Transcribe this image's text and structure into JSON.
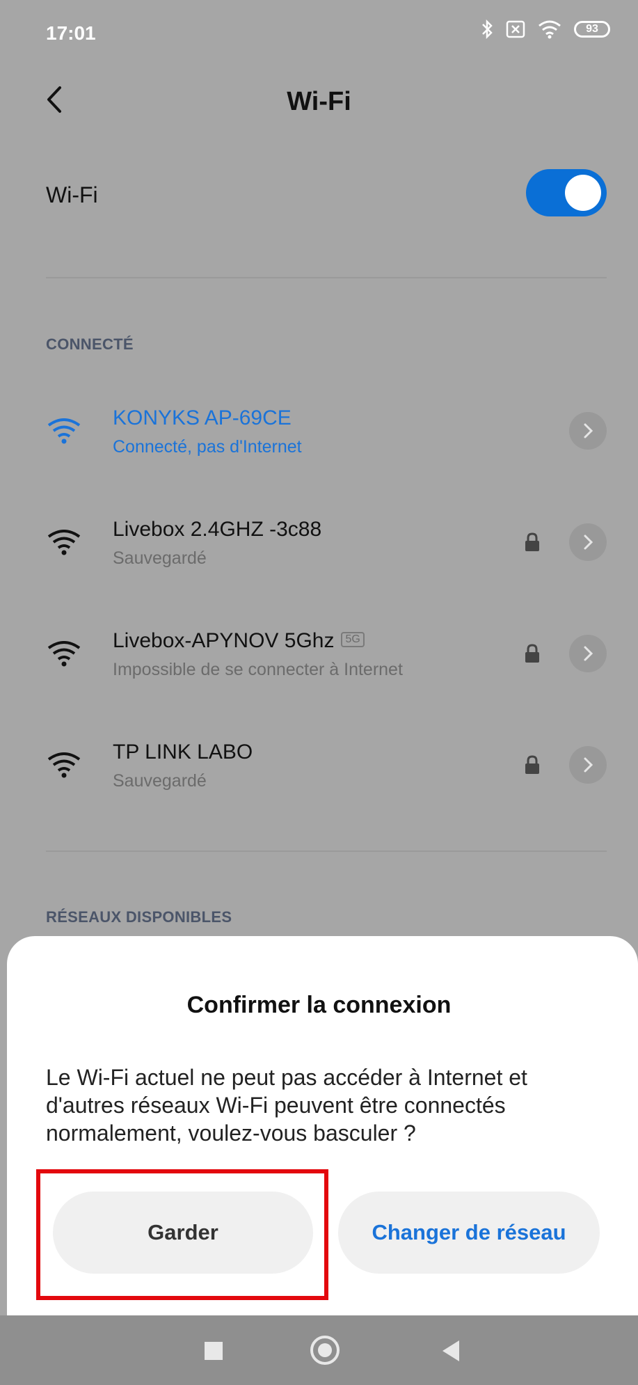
{
  "status_bar": {
    "time": "17:01",
    "battery": "93"
  },
  "header": {
    "title": "Wi-Fi"
  },
  "wifi_toggle": {
    "label": "Wi-Fi",
    "state": "on"
  },
  "connected": {
    "section_label": "CONNECTÉ",
    "networks": [
      {
        "name": "KONYKS AP-69CE",
        "status": "Connecté, pas d'Internet",
        "active": true,
        "locked": false
      },
      {
        "name": "Livebox 2.4GHZ -3c88",
        "status": "Sauvegardé",
        "active": false,
        "locked": true
      },
      {
        "name": "Livebox-APYNOV 5Ghz",
        "badge": "5G",
        "status": "Impossible de se connecter à Internet",
        "active": false,
        "locked": true
      },
      {
        "name": "TP LINK LABO",
        "status": "Sauvegardé",
        "active": false,
        "locked": true
      }
    ]
  },
  "available": {
    "section_label": "RÉSEAUX DISPONIBLES"
  },
  "dialog": {
    "title": "Confirmer la connexion",
    "message": "Le Wi-Fi actuel ne peut pas accéder à Internet et d'autres réseaux Wi-Fi peuvent être connectés normalement, voulez-vous basculer ?",
    "keep_label": "Garder",
    "switch_label": "Changer de réseau"
  },
  "colors": {
    "accent": "#0a6fd6",
    "link": "#1a73d9",
    "highlight": "#e3080d"
  }
}
